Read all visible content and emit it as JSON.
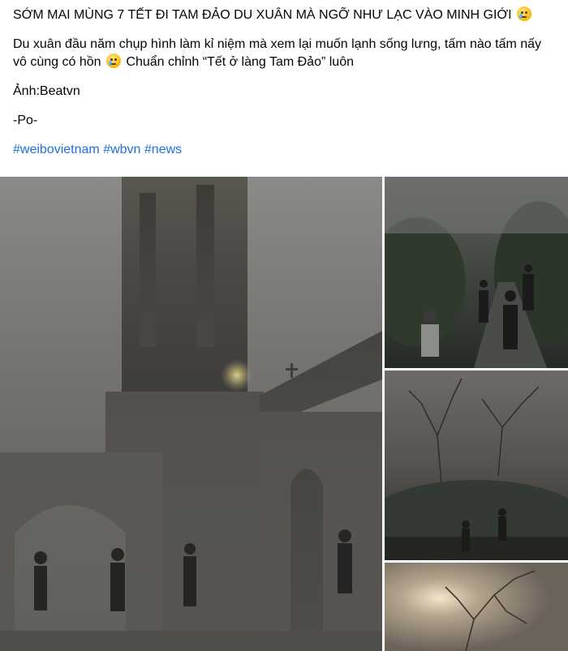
{
  "post": {
    "title_line": "SỚM MAI MÙNG 7 TẾT ĐI TAM ĐẢO DU XUÂN MÀ NGỠ NHƯ LẠC VÀO MINH GIỚI",
    "body_part1": "Du xuân đầu năm chụp hình làm kỉ niệm mà xem lại muốn lạnh sống lưng, tấm nào tấm nấy vô cùng có hồn",
    "body_part2": " Chuẩn chỉnh “Tết ở làng Tam Đảo” luôn",
    "credit": "Ảnh:Beatvn",
    "signature": "-Po-",
    "hashtags": [
      "#weibovietnam",
      "#wbvn",
      "#news"
    ],
    "emoji": "crying-face"
  },
  "gallery": {
    "photos": [
      {
        "subject": "foggy-church-tower-with-people"
      },
      {
        "subject": "foggy-forest-path-with-people"
      },
      {
        "subject": "foggy-trees-with-people"
      },
      {
        "subject": "foggy-sun-through-branches"
      }
    ]
  }
}
